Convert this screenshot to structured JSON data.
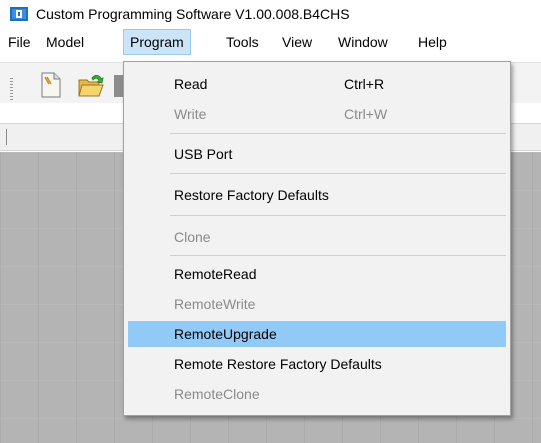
{
  "window": {
    "title": "Custom Programming Software V1.00.008.B4CHS",
    "icon": "app-icon"
  },
  "menubar": {
    "items": [
      {
        "label": "File"
      },
      {
        "label": "Model"
      },
      {
        "label": "Program",
        "active": true
      },
      {
        "label": "Tools"
      },
      {
        "label": "View"
      },
      {
        "label": "Window"
      },
      {
        "label": "Help"
      }
    ]
  },
  "toolbar": {
    "buttons": [
      {
        "icon": "new-file-icon"
      },
      {
        "icon": "open-folder-icon"
      },
      {
        "icon": "save-icon"
      }
    ]
  },
  "program_menu": {
    "items": [
      {
        "label": "Read",
        "shortcut": "Ctrl+R",
        "enabled": true
      },
      {
        "label": "Write",
        "shortcut": "Ctrl+W",
        "enabled": false
      },
      {
        "label": "USB Port",
        "shortcut": "",
        "enabled": true
      },
      {
        "label": "Restore Factory Defaults",
        "shortcut": "",
        "enabled": true
      },
      {
        "label": "Clone",
        "shortcut": "",
        "enabled": false
      },
      {
        "label": "RemoteRead",
        "shortcut": "",
        "enabled": true
      },
      {
        "label": "RemoteWrite",
        "shortcut": "",
        "enabled": false
      },
      {
        "label": "RemoteUpgrade",
        "shortcut": "",
        "enabled": true,
        "highlighted": true
      },
      {
        "label": "Remote Restore Factory Defaults",
        "shortcut": "",
        "enabled": true
      },
      {
        "label": "RemoteClone",
        "shortcut": "",
        "enabled": false
      }
    ]
  },
  "colors": {
    "highlight": "#91c9f7",
    "menu_active": "#cce4f7",
    "workspace": "#b4b4b4",
    "disabled_text": "#8a8a8a"
  }
}
